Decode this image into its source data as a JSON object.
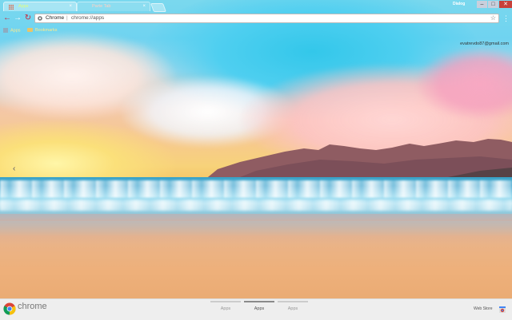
{
  "browser": {
    "tabs": [
      {
        "label": "Apps",
        "active": true
      },
      {
        "label": "Parte Tab",
        "active": false
      }
    ],
    "profile_name": "Dialog",
    "window_controls": {
      "minimize": "–",
      "maximize": "□",
      "close": "✕"
    }
  },
  "toolbar": {
    "back_icon": "arrow-left-icon",
    "forward_icon": "arrow-right-icon",
    "reload_icon": "reload-icon",
    "omnibox": {
      "host": "Chrome",
      "separator": "|",
      "url": "chrome://apps"
    },
    "star_icon": "star-icon",
    "menu_icon": "menu-icon"
  },
  "bookmarks": {
    "apps_label": "Apps",
    "folder_label": "Bookmarks"
  },
  "ntp": {
    "user_email": "evatrevdo87@gmail.com",
    "prev_page_icon": "chevron-left-icon"
  },
  "bottom_bar": {
    "logo_text": "chrome",
    "pages": [
      {
        "label": "Apps",
        "selected": false
      },
      {
        "label": "Apps",
        "selected": true
      },
      {
        "label": "Apps",
        "selected": false
      }
    ],
    "webstore_label": "Web Store"
  },
  "colors": {
    "close_button": "#c8413a",
    "bottom_bar_bg": "#eeeeee",
    "active_tab_text": "#e0ff7a"
  }
}
